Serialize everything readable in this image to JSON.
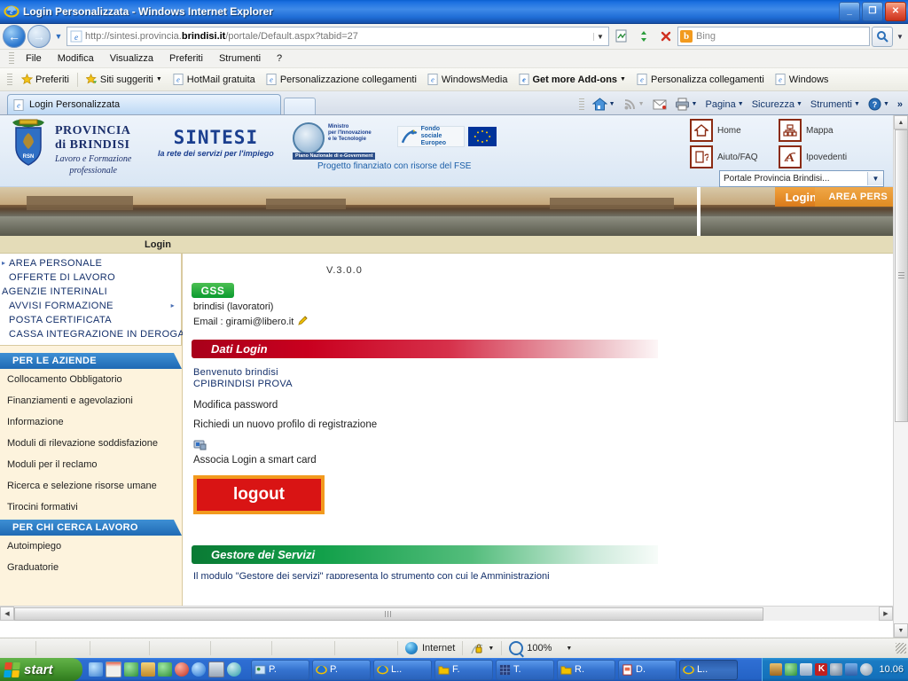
{
  "window": {
    "title": "Login Personalizzata - Windows Internet Explorer",
    "minimize": "_",
    "maximize": "❐",
    "close": "✕"
  },
  "navbar": {
    "back_icon": "←",
    "forward_icon": "→",
    "history_caret": "▼",
    "url_prefix": "http://sintesi.provincia.",
    "url_bold": "brindisi.it",
    "url_suffix": "/portale/Default.aspx?tabid=27",
    "address_caret": "▼",
    "compat_icon": "compatibility-view-icon",
    "refresh_icon": "↻",
    "stop_icon": "✕",
    "search_placeholder": "Bing",
    "search_logo": "b",
    "search_go": "⌕",
    "search_caret": "▼"
  },
  "menubar": {
    "items": [
      "File",
      "Modifica",
      "Visualizza",
      "Preferiti",
      "Strumenti",
      "?"
    ]
  },
  "favbar": {
    "favorites_label": "Preferiti",
    "items": [
      {
        "label": "Siti suggeriti",
        "caret": true,
        "bold": false
      },
      {
        "label": "HotMail gratuita",
        "caret": false,
        "bold": false
      },
      {
        "label": "Personalizzazione collegamenti",
        "caret": false,
        "bold": false
      },
      {
        "label": "WindowsMedia",
        "caret": false,
        "bold": false
      },
      {
        "label": "Get more Add-ons",
        "caret": true,
        "bold": true
      },
      {
        "label": "Personalizza collegamenti",
        "caret": false,
        "bold": false
      },
      {
        "label": "Windows",
        "caret": false,
        "bold": false
      }
    ]
  },
  "tabs": {
    "active_tab": "Login Personalizzata",
    "new_tab_label": ""
  },
  "commandbar": {
    "home": "home-icon",
    "feeds": "rss-icon",
    "mail": "mail-icon",
    "print": "print-icon",
    "items": [
      "Pagina",
      "Sicurezza",
      "Strumenti"
    ],
    "help": "?",
    "overflow": "»",
    "caret": "▼"
  },
  "page": {
    "header": {
      "province_line1": "PROVINCIA",
      "province_line2": "di BRINDISI",
      "province_sub1": "Lavoro e Formazione",
      "province_sub2": "professionale",
      "sintesi_word": "SINTESI",
      "sintesi_tagline": "la rete dei servizi per l'impiego",
      "ministry_line1": "Ministro",
      "ministry_line2": "per l'Innovazione",
      "ministry_line3": "e le Tecnologie",
      "pnego_label": "Piano Nazionale di e-Government",
      "fse_line1": "Fondo sociale",
      "fse_line2": "Europeo",
      "project_text": "Progetto finanziato con risorse del FSE",
      "topnav": [
        {
          "label": "Home",
          "icon": "home-icon"
        },
        {
          "label": "Mappa",
          "icon": "sitemap-icon"
        },
        {
          "label": "Aiuto/FAQ",
          "icon": "help-faq-icon"
        },
        {
          "label": "Ipovedenti",
          "icon": "accessibility-icon"
        }
      ],
      "portal_select": "Portale Provincia Brindisi...",
      "select_caret": "▼"
    },
    "banner": {
      "login_tab": "Login",
      "area_personale": "AREA PERS"
    },
    "loginbar": "Login",
    "sidebar": {
      "top_menu": [
        {
          "label": "AREA PERSONALE",
          "bullet": true,
          "arrow": false,
          "indent": true
        },
        {
          "label": "OFFERTE DI LAVORO",
          "bullet": false,
          "arrow": false,
          "indent": true
        },
        {
          "label": "AGENZIE INTERINALI",
          "bullet": false,
          "arrow": false,
          "indent": false
        },
        {
          "label": "AVVISI FORMAZIONE",
          "bullet": false,
          "arrow": true,
          "indent": true
        },
        {
          "label": "POSTA CERTIFICATA",
          "bullet": false,
          "arrow": false,
          "indent": true
        },
        {
          "label": "CASSA INTEGRAZIONE IN DEROGA",
          "bullet": false,
          "arrow": false,
          "indent": true
        }
      ],
      "section_aziende": "PER LE AZIENDE",
      "aziende_links": [
        "Collocamento Obbligatorio",
        "Finanziamenti e agevolazioni",
        "Informazione",
        "Moduli di rilevazione soddisfazione",
        "Moduli per il reclamo",
        "Ricerca e selezione risorse umane",
        "Tirocini formativi"
      ],
      "section_lavoro": "PER CHI CERCA LAVORO",
      "lavoro_links": [
        "Autoimpiego",
        "Graduatorie"
      ]
    },
    "main": {
      "version": "V.3.0.0",
      "gss_badge": "GSS",
      "user_line": "brindisi (lavoratori)",
      "email_label": "Email : girami@libero.it",
      "edit_icon": "pencil-icon",
      "dati_login_title": "Dati Login",
      "welcome_line1": "Benvenuto brindisi",
      "welcome_line2": "CPIBRINDISI PROVA",
      "link_modifica_password": "Modifica password",
      "link_nuovo_profilo": "Richiedi un nuovo profilo di registrazione",
      "smartcard_icon": "smartcard-icon",
      "link_smartcard": "Associa Login a smart card",
      "logout_button": "logout",
      "gestore_title": "Gestore dei Servizi",
      "gestore_desc": "Il modulo \"Gestore dei servizi\" rappresenta lo strumento con cui le Amministrazioni"
    }
  },
  "statusbar": {
    "zone": "Internet",
    "protected_icon": "lock-icon",
    "zoom": "100%",
    "caret": "▼"
  },
  "taskbar": {
    "start": "start",
    "quicklaunch": [
      "media-icon",
      "calendar-icon",
      "editor-icon",
      "tool-icon",
      "phone-icon",
      "record-icon",
      "browser-icon",
      "window-icon",
      "player-icon"
    ],
    "buttons": [
      {
        "label": "P.",
        "icon": "app-icon",
        "active": false
      },
      {
        "label": "P.",
        "icon": "ie-icon",
        "active": false
      },
      {
        "label": "L..",
        "icon": "ie-icon",
        "active": false
      },
      {
        "label": "F.",
        "icon": "folder-icon",
        "active": false
      },
      {
        "label": "T.",
        "icon": "grid-icon",
        "active": false
      },
      {
        "label": "R.",
        "icon": "folder-icon",
        "active": false
      },
      {
        "label": "D.",
        "icon": "doc-icon",
        "active": false
      },
      {
        "label": "L..",
        "icon": "ie-icon",
        "active": true
      }
    ],
    "tray_icons": [
      "calc-icon",
      "update-icon",
      "mail-icon",
      "antivirus-icon",
      "network-icon",
      "display-icon",
      "volume-icon"
    ],
    "clock": "10.06"
  }
}
